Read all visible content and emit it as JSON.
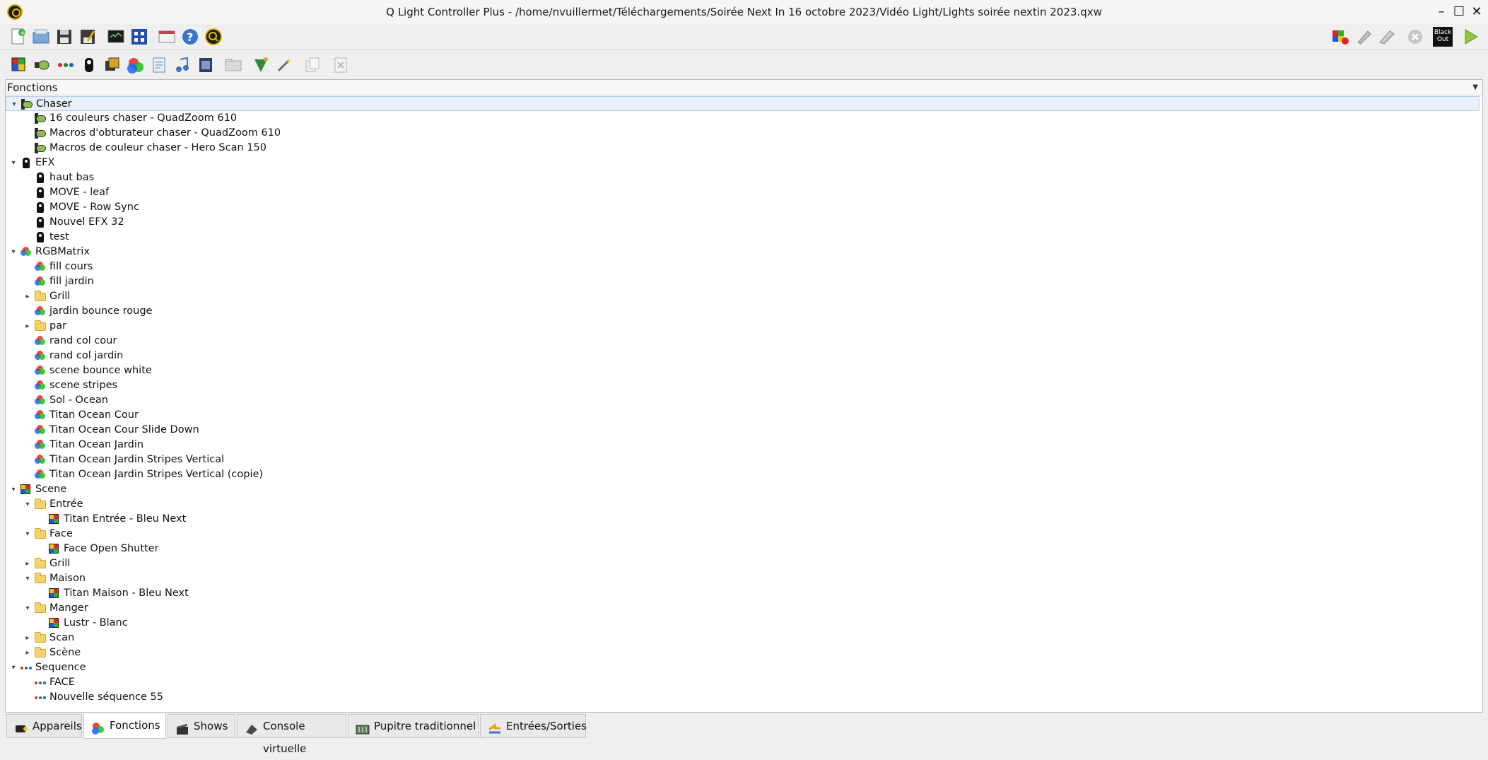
{
  "window": {
    "title": "Q Light Controller Plus - /home/nvuillermet/Téléchargements/Soirée Next In 16 octobre 2023/Vidéo Light/Lights soirée nextin 2023.qxw",
    "minimize": "–",
    "maximize": "☐",
    "close": "✕"
  },
  "toolbar_main": [
    {
      "name": "new-file-icon"
    },
    {
      "name": "open-file-icon"
    },
    {
      "name": "save-icon"
    },
    {
      "name": "save-as-icon"
    },
    {
      "name": "monitor-icon"
    },
    {
      "name": "address-tool-icon"
    },
    {
      "name": "fullscreen-icon"
    },
    {
      "name": "help-icon"
    },
    {
      "name": "about-icon"
    }
  ],
  "toolbar_right": {
    "blackout_label": "Black Out"
  },
  "panel": {
    "header": "Fonctions"
  },
  "tree": [
    {
      "label": "Chaser",
      "level": 0,
      "icon": "chaser",
      "exp": "open",
      "selected": true
    },
    {
      "label": "16 couleurs chaser - QuadZoom 610",
      "level": 1,
      "icon": "chaser"
    },
    {
      "label": "Macros d'obturateur chaser - QuadZoom 610",
      "level": 1,
      "icon": "chaser"
    },
    {
      "label": "Macros de couleur chaser - Hero Scan 150",
      "level": 1,
      "icon": "chaser"
    },
    {
      "label": "EFX",
      "level": 0,
      "icon": "efx",
      "exp": "open"
    },
    {
      "label": "haut bas",
      "level": 1,
      "icon": "efx"
    },
    {
      "label": "MOVE - leaf",
      "level": 1,
      "icon": "efx"
    },
    {
      "label": "MOVE - Row Sync",
      "level": 1,
      "icon": "efx"
    },
    {
      "label": "Nouvel EFX 32",
      "level": 1,
      "icon": "efx"
    },
    {
      "label": "test",
      "level": 1,
      "icon": "efx"
    },
    {
      "label": "RGBMatrix",
      "level": 0,
      "icon": "rgb",
      "exp": "open"
    },
    {
      "label": "fill cours",
      "level": 1,
      "icon": "rgb"
    },
    {
      "label": "fill jardin",
      "level": 1,
      "icon": "rgb"
    },
    {
      "label": "Grill",
      "level": 1,
      "icon": "folder",
      "exp": "closed"
    },
    {
      "label": "jardin bounce rouge",
      "level": 1,
      "icon": "rgb"
    },
    {
      "label": "par",
      "level": 1,
      "icon": "folder",
      "exp": "closed"
    },
    {
      "label": "rand col cour",
      "level": 1,
      "icon": "rgb"
    },
    {
      "label": "rand col jardin",
      "level": 1,
      "icon": "rgb"
    },
    {
      "label": "scene bounce white",
      "level": 1,
      "icon": "rgb"
    },
    {
      "label": "scene stripes",
      "level": 1,
      "icon": "rgb"
    },
    {
      "label": "Sol - Ocean",
      "level": 1,
      "icon": "rgb"
    },
    {
      "label": "Titan Ocean Cour",
      "level": 1,
      "icon": "rgb"
    },
    {
      "label": "Titan Ocean Cour Slide Down",
      "level": 1,
      "icon": "rgb"
    },
    {
      "label": "Titan Ocean Jardin",
      "level": 1,
      "icon": "rgb"
    },
    {
      "label": "Titan Ocean Jardin Stripes Vertical",
      "level": 1,
      "icon": "rgb"
    },
    {
      "label": "Titan Ocean Jardin Stripes Vertical (copie)",
      "level": 1,
      "icon": "rgb"
    },
    {
      "label": "Scene",
      "level": 0,
      "icon": "scene",
      "exp": "open"
    },
    {
      "label": "Entrée",
      "level": 1,
      "icon": "folder",
      "exp": "open"
    },
    {
      "label": "Titan Entrée - Bleu Next",
      "level": 2,
      "icon": "scene"
    },
    {
      "label": "Face",
      "level": 1,
      "icon": "folder",
      "exp": "open"
    },
    {
      "label": "Face Open Shutter",
      "level": 2,
      "icon": "scene"
    },
    {
      "label": "Grill",
      "level": 1,
      "icon": "folder",
      "exp": "closed"
    },
    {
      "label": "Maison",
      "level": 1,
      "icon": "folder",
      "exp": "open"
    },
    {
      "label": "Titan Maison - Bleu Next",
      "level": 2,
      "icon": "scene"
    },
    {
      "label": "Manger",
      "level": 1,
      "icon": "folder",
      "exp": "open"
    },
    {
      "label": "Lustr - Blanc",
      "level": 2,
      "icon": "scene"
    },
    {
      "label": "Scan",
      "level": 1,
      "icon": "folder",
      "exp": "closed"
    },
    {
      "label": "Scène",
      "level": 1,
      "icon": "folder",
      "exp": "closed"
    },
    {
      "label": "Sequence",
      "level": 0,
      "icon": "seq",
      "exp": "open"
    },
    {
      "label": "FACE",
      "level": 1,
      "icon": "seq"
    },
    {
      "label": "Nouvelle séquence 55",
      "level": 1,
      "icon": "seq"
    }
  ],
  "tabs": [
    {
      "label": "Appareils",
      "icon": "fixture-icon",
      "active": false
    },
    {
      "label": "Fonctions",
      "icon": "functions-icon",
      "active": true
    },
    {
      "label": "Shows",
      "icon": "shows-icon",
      "active": false
    },
    {
      "label": "Console virtuelle",
      "icon": "virtual-console-icon",
      "active": false
    },
    {
      "label": "Pupitre traditionnel",
      "icon": "simple-desk-icon",
      "active": false
    },
    {
      "label": "Entrées/Sorties",
      "icon": "input-output-icon",
      "active": false
    }
  ],
  "colors": {
    "selection_bg": "#e8f0fa",
    "panel_bg": "#ffffff",
    "chrome_bg": "#efefef"
  }
}
